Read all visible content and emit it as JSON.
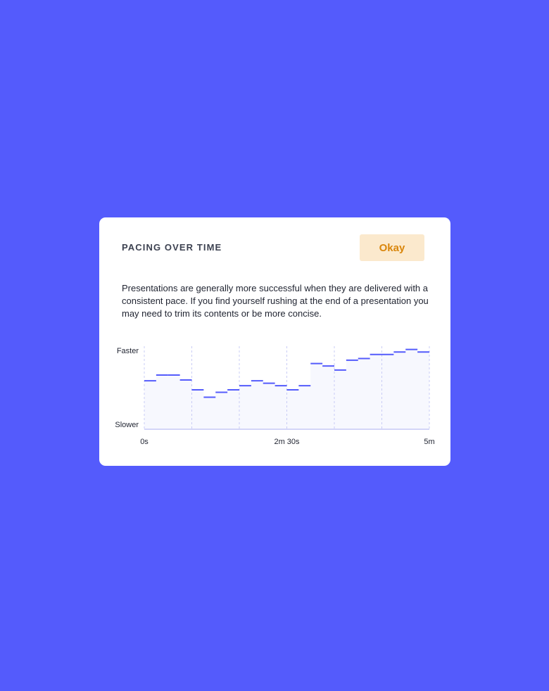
{
  "card": {
    "title": "PACING OVER TIME",
    "badge": "Okay",
    "description": "Presentations are generally more successful when they are delivered with a consistent pace. If you find yourself rushing at the end of a presentation you may need to trim its contents or be more concise."
  },
  "colors": {
    "background": "#545bfc",
    "line": "#545bfc",
    "fill": "#f7f8fe",
    "badge_bg": "#fbe9cd",
    "badge_text": "#d9860c"
  },
  "chart_data": {
    "type": "line",
    "title": "",
    "xlabel": "",
    "ylabel": "",
    "y_top_label": "Faster",
    "y_bottom_label": "Slower",
    "x_ticks": [
      {
        "label": "0s",
        "value": 0
      },
      {
        "label": "2m 30s",
        "value": 150
      },
      {
        "label": "5m",
        "value": 300
      }
    ],
    "xlim": [
      0,
      300
    ],
    "ylim": [
      0,
      100
    ],
    "gridlines_x": [
      0,
      50,
      100,
      150,
      200,
      250,
      300
    ],
    "segment_width": 12.5,
    "series": [
      {
        "values": [
          58,
          65,
          65,
          59,
          47,
          38,
          44,
          47,
          52,
          58,
          55,
          52,
          47,
          52,
          79,
          76,
          71,
          83,
          85,
          90,
          90,
          93,
          96,
          93
        ]
      }
    ]
  }
}
